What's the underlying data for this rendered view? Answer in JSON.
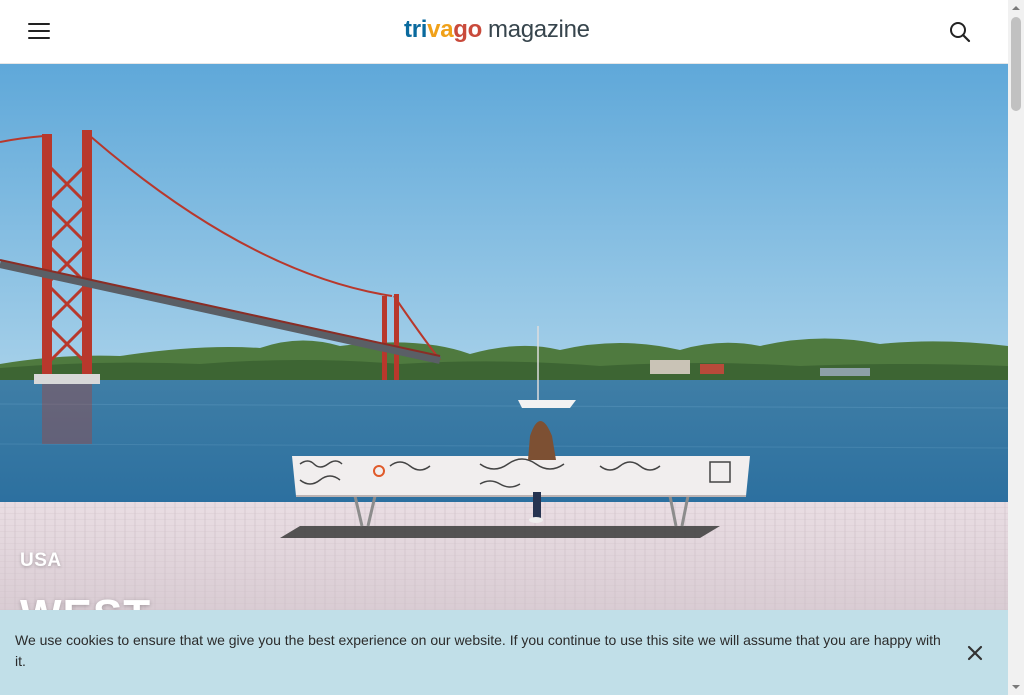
{
  "header": {
    "logo_letters": [
      {
        "ch": "t",
        "color": "#0a6a9e"
      },
      {
        "ch": "r",
        "color": "#0a6a9e"
      },
      {
        "ch": "i",
        "color": "#0a6a9e"
      },
      {
        "ch": "v",
        "color": "#f0a119"
      },
      {
        "ch": "a",
        "color": "#f0a119"
      },
      {
        "ch": "g",
        "color": "#c94a3b"
      },
      {
        "ch": "o",
        "color": "#c94a3b"
      }
    ],
    "logo_suffix": "magazine",
    "menu_icon": "hamburger-menu-icon",
    "search_icon": "search-icon"
  },
  "hero": {
    "country": "USA",
    "title": "WEST"
  },
  "cookie_banner": {
    "text": "We use cookies to ensure that we give you the best experience on our website. If you continue to use this site we will assume that you are happy with it.",
    "close_icon": "close-icon"
  },
  "colors": {
    "banner_bg": "#c1dfe8",
    "bridge_red": "#b8382c"
  }
}
